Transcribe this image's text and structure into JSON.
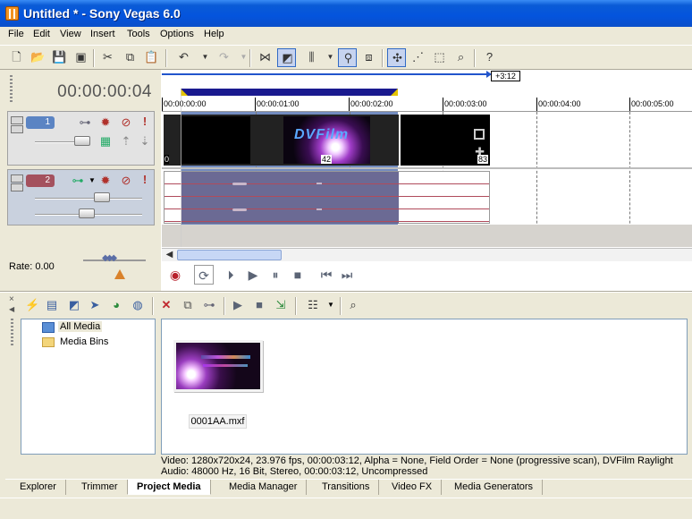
{
  "window": {
    "title": "Untitled * - Sony Vegas 6.0"
  },
  "menu": [
    "File",
    "Edit",
    "View",
    "Insert",
    "Tools",
    "Options",
    "Help"
  ],
  "timeline": {
    "cursor_timecode": "00:00:00:04",
    "end_marker": "+3:12",
    "ruler_labels": [
      "00:00:00:00",
      "00:00:01:00",
      "00:00:02:00",
      "00:00:03:00",
      "00:00:04:00",
      "00:00:05:00"
    ],
    "clip_frame_start": "0",
    "clip_frame_mid": "42",
    "clip_frame_end": "83",
    "clip_text": "DVFilm"
  },
  "tracks": [
    {
      "number": "1",
      "type": "video",
      "color": "#5B84C3"
    },
    {
      "number": "2",
      "type": "audio",
      "color": "#A4515E"
    }
  ],
  "rate": {
    "label": "Rate: 0.00"
  },
  "project_media": {
    "tree": [
      "All Media",
      "Media Bins"
    ],
    "file_name": "0001AA.mxf",
    "info_line1": "Video: 1280x720x24, 23.976 fps, 00:00:03:12, Alpha = None, Field Order = None (progressive scan), DVFilm Raylight",
    "info_line2": "Audio: 48000 Hz, 16 Bit, Stereo, 00:00:03:12, Uncompressed"
  },
  "tabs": [
    "Explorer",
    "Trimmer",
    "Project Media",
    "Media Manager",
    "Transitions",
    "Video FX",
    "Media Generators"
  ],
  "active_tab": "Project Media"
}
